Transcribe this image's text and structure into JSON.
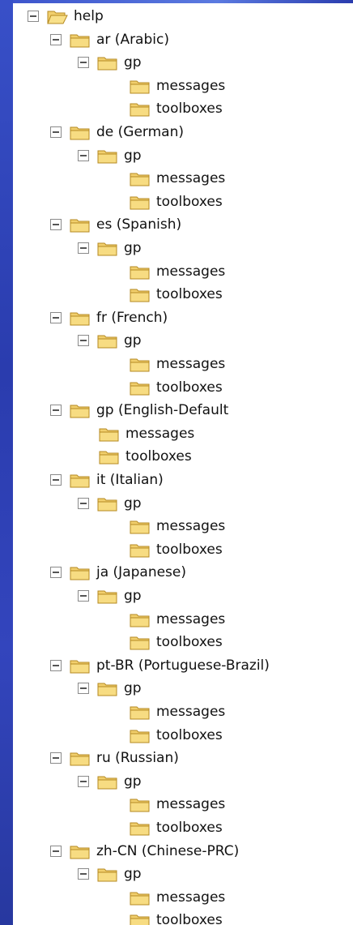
{
  "tree": [
    {
      "label": "help",
      "depth": 0,
      "toggle": "collapse",
      "open": true
    },
    {
      "label": "ar (Arabic)",
      "depth": 1,
      "toggle": "collapse"
    },
    {
      "label": "gp",
      "depth": 2,
      "toggle": "collapse"
    },
    {
      "label": "messages",
      "depth": 3
    },
    {
      "label": "toolboxes",
      "depth": 3
    },
    {
      "label": "de (German)",
      "depth": 1,
      "toggle": "collapse"
    },
    {
      "label": "gp",
      "depth": 2,
      "toggle": "collapse"
    },
    {
      "label": "messages",
      "depth": 3
    },
    {
      "label": "toolboxes",
      "depth": 3
    },
    {
      "label": "es (Spanish)",
      "depth": 1,
      "toggle": "collapse"
    },
    {
      "label": "gp",
      "depth": 2,
      "toggle": "collapse"
    },
    {
      "label": "messages",
      "depth": 3
    },
    {
      "label": "toolboxes",
      "depth": 3
    },
    {
      "label": "fr (French)",
      "depth": 1,
      "toggle": "collapse"
    },
    {
      "label": "gp",
      "depth": 2,
      "toggle": "collapse"
    },
    {
      "label": "messages",
      "depth": 3
    },
    {
      "label": "toolboxes",
      "depth": 3
    },
    {
      "label": "gp (English-Default",
      "depth": 1,
      "toggle": "collapse"
    },
    {
      "label": "messages",
      "depth": 2
    },
    {
      "label": "toolboxes",
      "depth": 2
    },
    {
      "label": "it (Italian)",
      "depth": 1,
      "toggle": "collapse"
    },
    {
      "label": "gp",
      "depth": 2,
      "toggle": "collapse"
    },
    {
      "label": "messages",
      "depth": 3
    },
    {
      "label": "toolboxes",
      "depth": 3
    },
    {
      "label": "ja (Japanese)",
      "depth": 1,
      "toggle": "collapse"
    },
    {
      "label": "gp",
      "depth": 2,
      "toggle": "collapse"
    },
    {
      "label": "messages",
      "depth": 3
    },
    {
      "label": "toolboxes",
      "depth": 3
    },
    {
      "label": "pt-BR (Portuguese-Brazil)",
      "depth": 1,
      "toggle": "collapse"
    },
    {
      "label": "gp",
      "depth": 2,
      "toggle": "collapse"
    },
    {
      "label": "messages",
      "depth": 3
    },
    {
      "label": "toolboxes",
      "depth": 3
    },
    {
      "label": "ru (Russian)",
      "depth": 1,
      "toggle": "collapse"
    },
    {
      "label": "gp",
      "depth": 2,
      "toggle": "collapse"
    },
    {
      "label": "messages",
      "depth": 3
    },
    {
      "label": "toolboxes",
      "depth": 3
    },
    {
      "label": "zh-CN (Chinese-PRC)",
      "depth": 1,
      "toggle": "collapse"
    },
    {
      "label": "gp",
      "depth": 2,
      "toggle": "collapse"
    },
    {
      "label": "messages",
      "depth": 3
    },
    {
      "label": "toolboxes",
      "depth": 3
    }
  ],
  "colors": {
    "background": "#2c3fb8",
    "panel": "#ffffff",
    "folder": "#f1cf6d",
    "folder_stroke": "#b58a22"
  }
}
